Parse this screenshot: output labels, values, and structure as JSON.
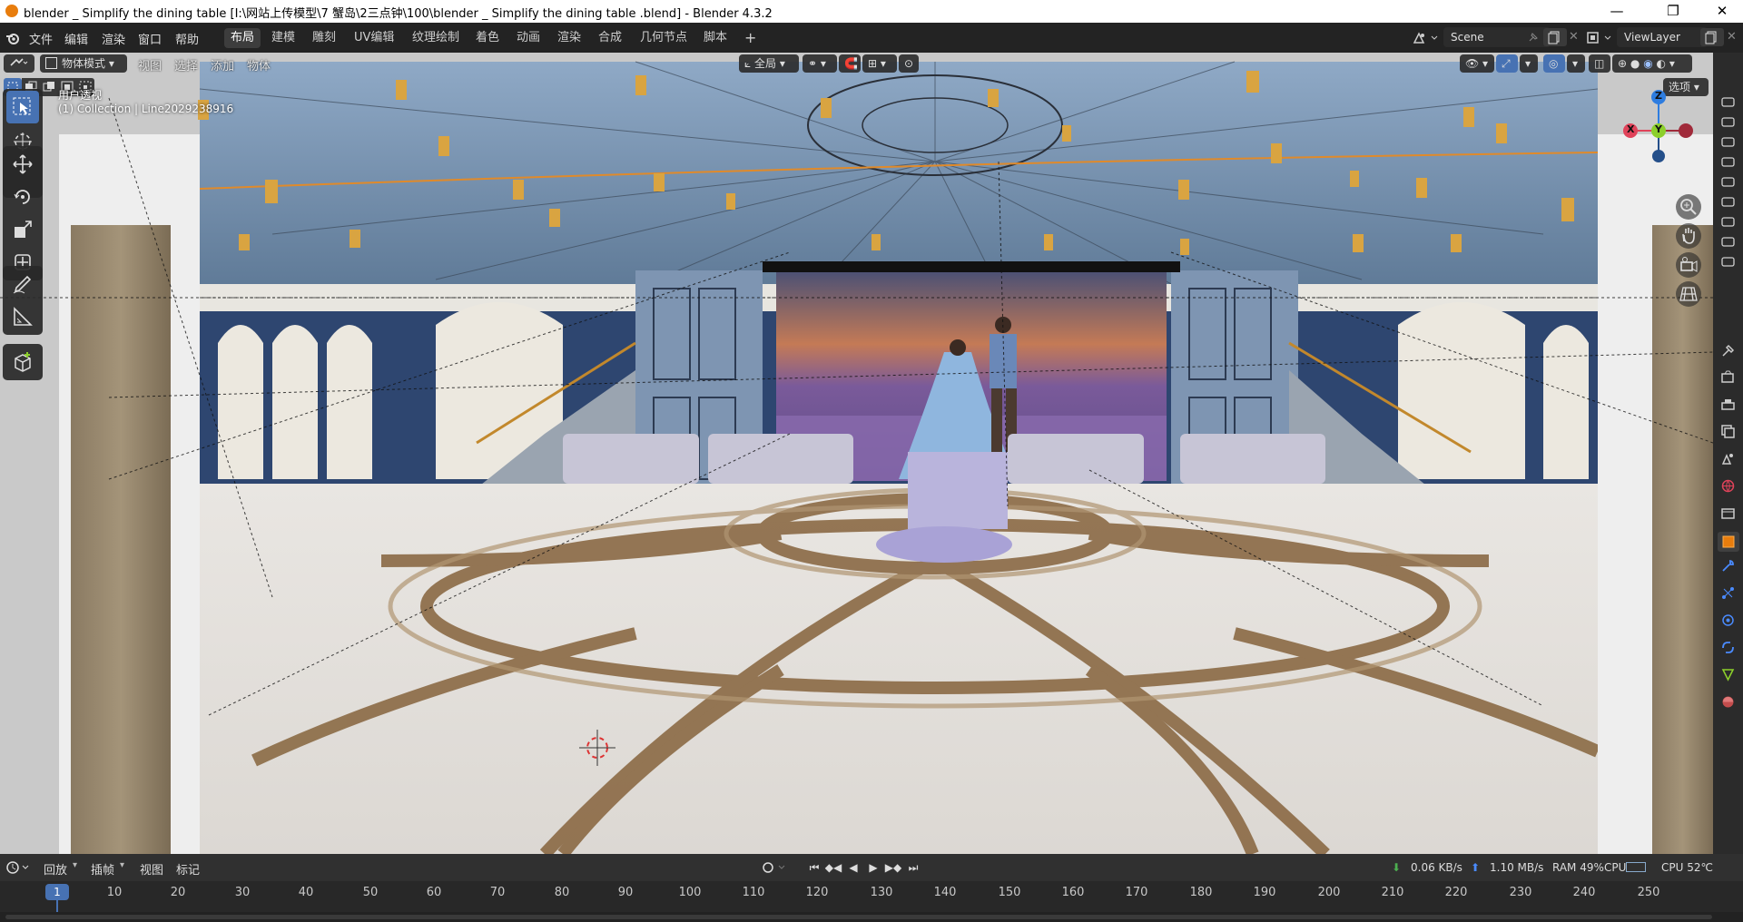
{
  "window": {
    "title": "blender _ Simplify the dining table  [I:\\网站上传模型\\7 蟹岛\\2三点钟\\100\\blender _ Simplify the dining table .blend] - Blender 4.3.2",
    "minimize": "—",
    "maximize": "❐",
    "close": "✕"
  },
  "menu": {
    "items": [
      "文件",
      "编辑",
      "渲染",
      "窗口",
      "帮助"
    ]
  },
  "workspaces": {
    "tabs": [
      "布局",
      "建模",
      "雕刻",
      "UV编辑",
      "纹理绘制",
      "着色",
      "动画",
      "渲染",
      "合成",
      "几何节点",
      "脚本"
    ],
    "active": "布局",
    "add": "+"
  },
  "scene": {
    "name": "Scene"
  },
  "viewlayer": {
    "name": "ViewLayer"
  },
  "viewport_header": {
    "mode": "物体模式",
    "menus": [
      "视图",
      "选择",
      "添加",
      "物体"
    ],
    "transform": "全局",
    "options": "选项"
  },
  "viewport_info": {
    "view_name": "用户透视",
    "collection": "(1) Collection | Line2029238916"
  },
  "gizmo": {
    "z": "Z",
    "y": "Y",
    "x": "X"
  },
  "tools": [
    "select-box",
    "cursor",
    "move",
    "rotate",
    "scale",
    "transform",
    "annotate",
    "measure",
    "add-cube"
  ],
  "timeline": {
    "menus": [
      "回放",
      "插帧",
      "视图",
      "标记"
    ],
    "current_frame": "1",
    "ticks": [
      "10",
      "20",
      "30",
      "40",
      "50",
      "60",
      "70",
      "80",
      "90",
      "100",
      "110",
      "120",
      "130",
      "140",
      "150",
      "160",
      "170",
      "180",
      "190",
      "200",
      "210",
      "220",
      "230",
      "240",
      "250"
    ]
  },
  "status": {
    "download": "0.06 KB/s",
    "upload": "1.10 MB/s",
    "ram": "RAM 49%",
    "cpu_label": "CPU",
    "cpu_temp": "CPU 52℃"
  },
  "colors": {
    "accent": "#4772b3",
    "orange": "#e87d0d",
    "axis_x": "#e0435a",
    "axis_y": "#8ccf2b",
    "axis_z": "#2e7de0"
  }
}
